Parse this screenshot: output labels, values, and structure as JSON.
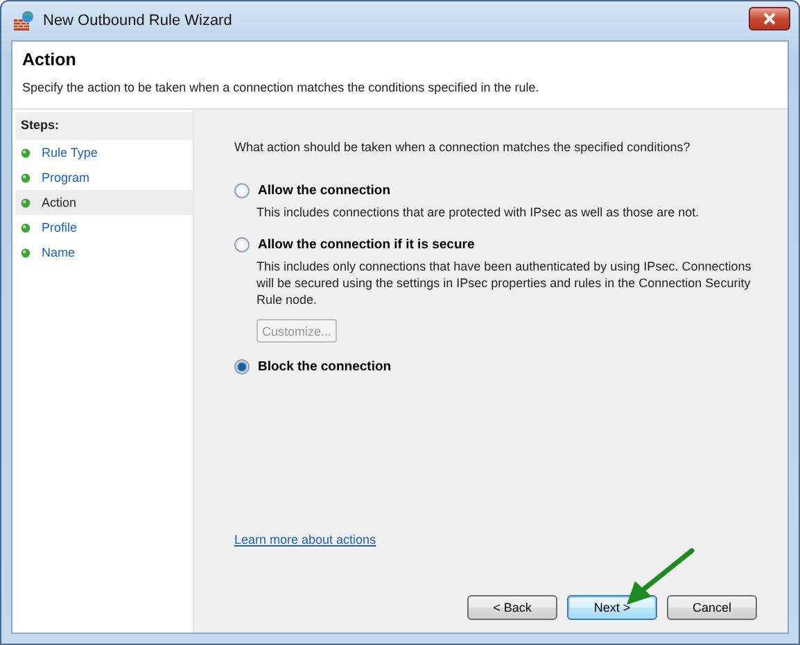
{
  "window": {
    "title": "New Outbound Rule Wizard"
  },
  "header": {
    "title": "Action",
    "description": "Specify the action to be taken when a connection matches the conditions specified in the rule."
  },
  "steps": {
    "heading": "Steps:",
    "items": [
      {
        "label": "Rule Type",
        "selected": false
      },
      {
        "label": "Program",
        "selected": false
      },
      {
        "label": "Action",
        "selected": true
      },
      {
        "label": "Profile",
        "selected": false
      },
      {
        "label": "Name",
        "selected": false
      }
    ]
  },
  "question": "What action should be taken when a connection matches the specified conditions?",
  "options": [
    {
      "label": "Allow the connection",
      "description": "This includes connections that are protected with IPsec as well as those are not.",
      "selected": false
    },
    {
      "label": "Allow the connection if it is secure",
      "description": "This includes only connections that have been authenticated by using IPsec.  Connections will be secured using the settings in IPsec properties and rules in the Connection Security Rule node.",
      "selected": false,
      "button": {
        "label": "Customize...",
        "disabled": true
      }
    },
    {
      "label": "Block the connection",
      "selected": true
    }
  ],
  "link": "Learn more about actions",
  "buttons": [
    {
      "label": "< Back",
      "focused": false
    },
    {
      "label": "Next >",
      "focused": true
    },
    {
      "label": "Cancel",
      "focused": false
    }
  ]
}
